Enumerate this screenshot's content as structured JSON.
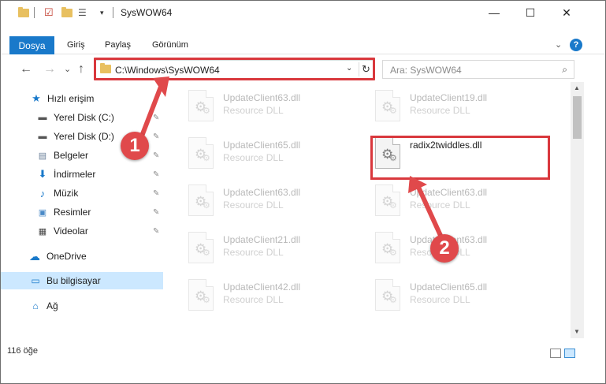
{
  "window": {
    "title": "SysWOW64"
  },
  "window_controls": {
    "minimize": "—",
    "maximize": "☐",
    "close": "✕"
  },
  "ribbon": {
    "tabs": [
      "Dosya",
      "Giriş",
      "Paylaş",
      "Görünüm"
    ],
    "expand_glyph": "⌄",
    "help_glyph": "?"
  },
  "address": {
    "path": "C:\\Windows\\SysWOW64",
    "dropdown_glyph": "⌄",
    "refresh_glyph": "↻"
  },
  "search": {
    "placeholder": "Ara: SysWOW64",
    "icon": "search-icon"
  },
  "nav_buttons": {
    "back": "←",
    "forward": "→",
    "recent": "⌄",
    "up": "↑"
  },
  "nav": {
    "items": [
      {
        "label": "Hızlı erişim",
        "icon": "star-icon",
        "pinned": false
      },
      {
        "label": "Yerel Disk (C:)",
        "icon": "drive-icon",
        "pinned": true
      },
      {
        "label": "Yerel Disk (D:)",
        "icon": "drive-icon",
        "pinned": true
      },
      {
        "label": "Belgeler",
        "icon": "documents-icon",
        "pinned": true
      },
      {
        "label": "İndirmeler",
        "icon": "download-icon",
        "pinned": true
      },
      {
        "label": "Müzik",
        "icon": "music-icon",
        "pinned": true
      },
      {
        "label": "Resimler",
        "icon": "pictures-icon",
        "pinned": true
      },
      {
        "label": "Videolar",
        "icon": "video-icon",
        "pinned": true
      },
      {
        "label": "OneDrive",
        "icon": "cloud-icon",
        "pinned": false
      },
      {
        "label": "Bu bilgisayar",
        "icon": "computer-icon",
        "pinned": false,
        "selected": true
      },
      {
        "label": "Ağ",
        "icon": "network-icon",
        "pinned": false
      }
    ]
  },
  "files": [
    {
      "name": "UpdateClient63.dll",
      "desc": "Resource DLL"
    },
    {
      "name": "UpdateClient19.dll",
      "desc": "Resource DLL"
    },
    {
      "name": "UpdateClient65.dll",
      "desc": "Resource DLL"
    },
    {
      "name": "radix2twiddles.dll",
      "desc": "",
      "active": true
    },
    {
      "name": "UpdateClient63.dll",
      "desc": "Resource DLL"
    },
    {
      "name": "UpdateClient63.dll",
      "desc": "Resource DLL"
    },
    {
      "name": "UpdateClient21.dll",
      "desc": "Resource DLL"
    },
    {
      "name": "UpdateClient63.dll",
      "desc": "Resource DLL"
    },
    {
      "name": "UpdateClient42.dll",
      "desc": "Resource DLL"
    },
    {
      "name": "UpdateClient65.dll",
      "desc": "Resource DLL"
    }
  ],
  "status": {
    "count": "116 öğe"
  },
  "callouts": {
    "one": "1",
    "two": "2"
  },
  "colors": {
    "accent": "#1979ca",
    "callout": "#e0494b",
    "highlight": "#d9383d",
    "selection": "#cce8ff"
  }
}
